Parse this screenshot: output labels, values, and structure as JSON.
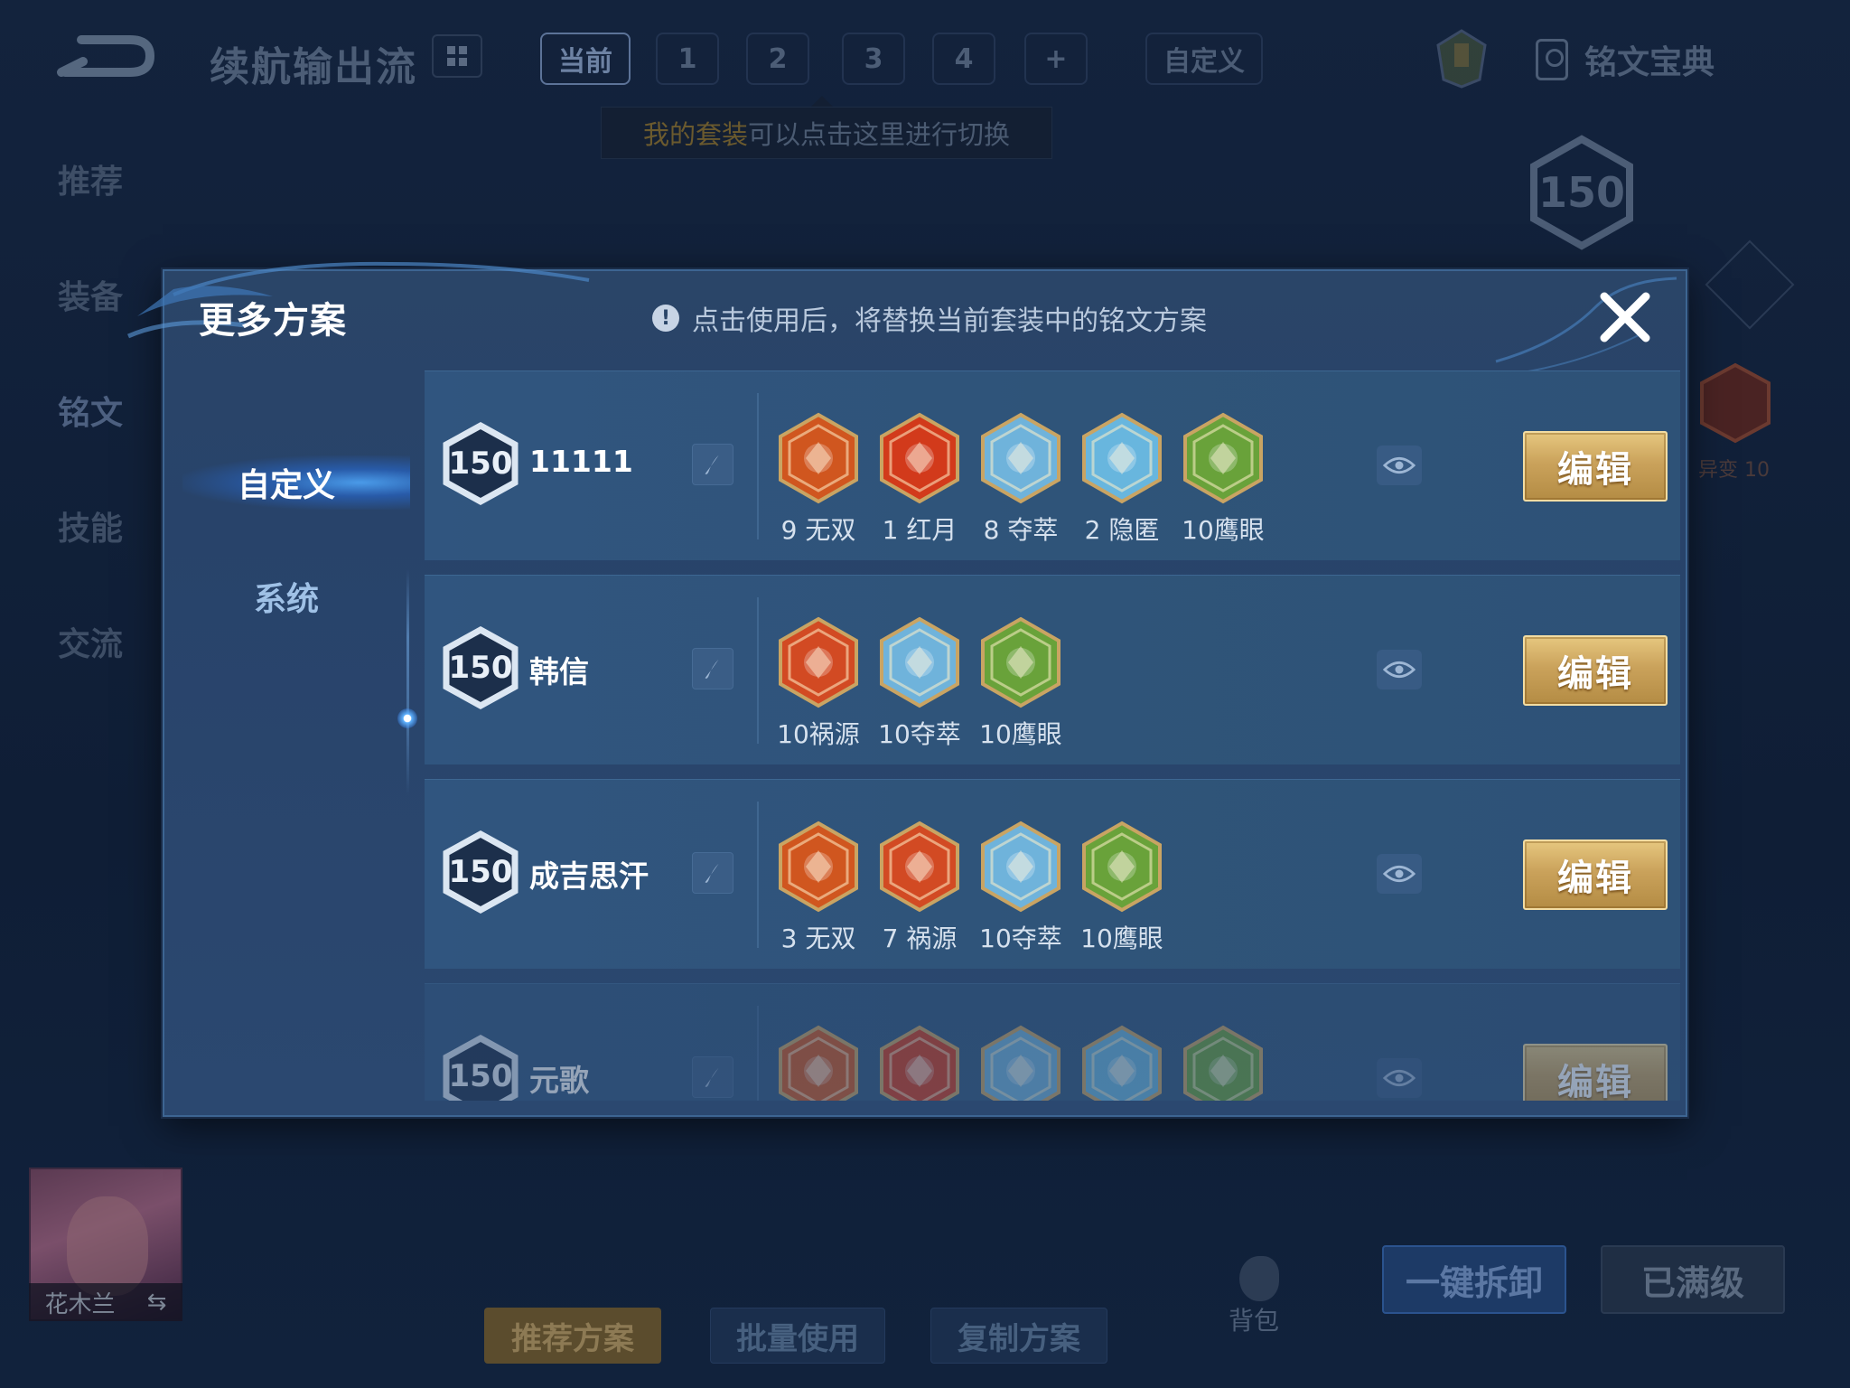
{
  "header": {
    "title": "续航输出流",
    "set_tabs": [
      "当前",
      "1",
      "2",
      "3",
      "4",
      "+"
    ],
    "custom_tab": "自定义",
    "tip": {
      "highlight": "我的套装",
      "rest": "可以点击这里进行切换"
    },
    "library_label": "铭文宝典"
  },
  "sidebar": {
    "items": [
      "推荐",
      "装备",
      "铭文",
      "技能",
      "交流"
    ]
  },
  "summary": {
    "total_level": "150",
    "rune_behind_label": "异变 10"
  },
  "hero": {
    "name": "花木兰"
  },
  "bottom_bar": {
    "recommend": "推荐方案",
    "batch_use": "批量使用",
    "copy": "复制方案",
    "bag": "背包",
    "unload_all": "一键拆卸",
    "maxed": "已满级"
  },
  "modal": {
    "title": "更多方案",
    "hint": "点击使用后，将替换当前套装中的铭文方案",
    "categories": [
      "自定义",
      "系统"
    ],
    "edit_label": "编辑",
    "plans": [
      {
        "level": "150",
        "name": "11111",
        "runes": [
          {
            "label": "9 无双",
            "color": "#d0561f"
          },
          {
            "label": "1 红月",
            "color": "#d23a1b"
          },
          {
            "label": "8 夺萃",
            "color": "#6fb3db"
          },
          {
            "label": "2 隐匿",
            "color": "#68b6de"
          },
          {
            "label": "10鹰眼",
            "color": "#69a23a"
          }
        ]
      },
      {
        "level": "150",
        "name": "韩信",
        "runes": [
          {
            "label": "10祸源",
            "color": "#d24a23"
          },
          {
            "label": "10夺萃",
            "color": "#6fb3db"
          },
          {
            "label": "10鹰眼",
            "color": "#69a23a"
          }
        ]
      },
      {
        "level": "150",
        "name": "成吉思汗",
        "runes": [
          {
            "label": "3 无双",
            "color": "#d0561f"
          },
          {
            "label": "7 祸源",
            "color": "#d24a23"
          },
          {
            "label": "10夺萃",
            "color": "#6fb3db"
          },
          {
            "label": "10鹰眼",
            "color": "#69a23a"
          }
        ]
      },
      {
        "level": "150",
        "name": "元歌",
        "runes": [
          {
            "label": "",
            "color": "#d0561f"
          },
          {
            "label": "",
            "color": "#d23a1b"
          },
          {
            "label": "",
            "color": "#6fb3db"
          },
          {
            "label": "",
            "color": "#68b6de"
          },
          {
            "label": "",
            "color": "#69a23a"
          }
        ]
      }
    ]
  }
}
